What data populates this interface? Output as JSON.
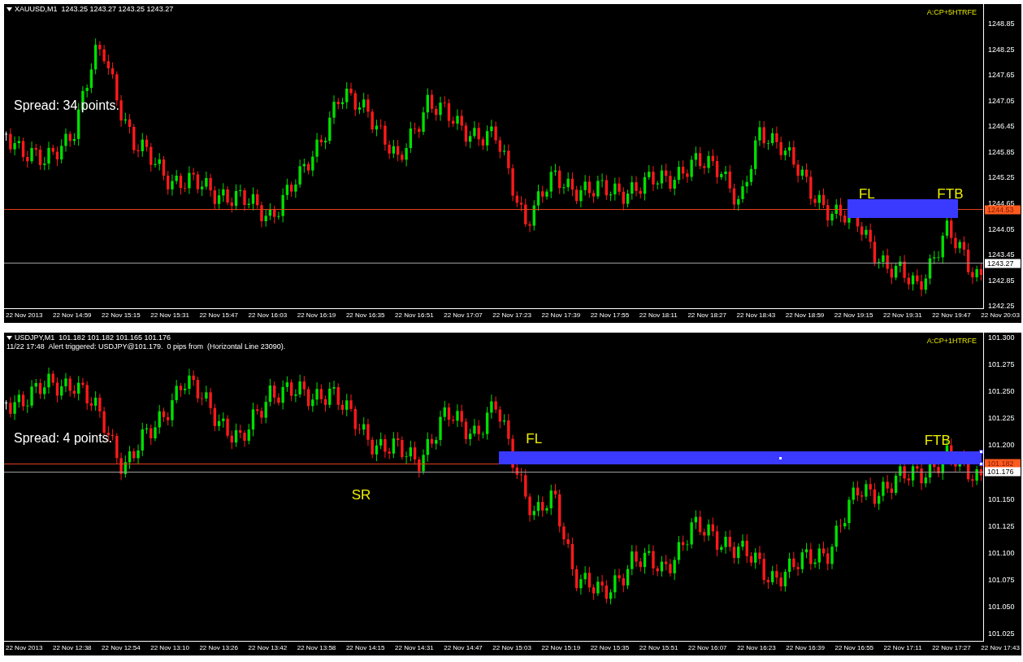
{
  "charts": [
    {
      "header": "XAUUSD,M1  1243.25 1243.27 1243.25 1243.27",
      "broker_label": "A:CP+5HTRFE",
      "spread": "Spread: 34 points.",
      "annotations": [
        {
          "text": "FL"
        },
        {
          "text": "FTB"
        }
      ],
      "price_ticks": [
        "1248.85",
        "1248.25",
        "1247.65",
        "1247.05",
        "1246.45",
        "1245.85",
        "1245.25",
        "1244.65",
        "1244.05",
        "1243.45",
        "1242.85",
        "1242.25"
      ],
      "price_badges": [
        {
          "kind": "line",
          "text": "1244.53"
        },
        {
          "kind": "bid",
          "text": "1243.27"
        }
      ],
      "time_labels": [
        "22 Nov 2013",
        "22 Nov 14:59",
        "22 Nov 15:15",
        "22 Nov 15:31",
        "22 Nov 15:47",
        "22 Nov 16:03",
        "22 Nov 16:19",
        "22 Nov 16:35",
        "22 Nov 16:51",
        "22 Nov 17:07",
        "22 Nov 17:23",
        "22 Nov 17:39",
        "22 Nov 17:55",
        "22 Nov 18:11",
        "22 Nov 18:27",
        "22 Nov 18:43",
        "22 Nov 18:59",
        "22 Nov 19:15",
        "22 Nov 19:31",
        "22 Nov 19:47",
        "22 Nov 20:03"
      ]
    },
    {
      "header": "USDJPY,M1  101.182 101.182 101.165 101.176",
      "alert": "11/22 17:48  Alert triggered: USDJPY@101.179.  0 pips from  (Horizontal Line 23090).",
      "broker_label": "A:CP+1HTRFE",
      "spread": "Spread: 4 points.",
      "annotations": [
        {
          "text": "FL"
        },
        {
          "text": "FTB"
        },
        {
          "text": "SR"
        }
      ],
      "price_ticks": [
        "101.300",
        "101.275",
        "101.250",
        "101.225",
        "101.200",
        "101.150",
        "101.125",
        "101.100",
        "101.075",
        "101.050",
        "101.025"
      ],
      "price_badges": [
        {
          "kind": "line",
          "text": "101.182"
        },
        {
          "kind": "bid",
          "text": "101.176"
        }
      ],
      "time_labels": [
        "22 Nov 2013",
        "22 Nov 12:38",
        "22 Nov 12:54",
        "22 Nov 13:10",
        "22 Nov 13:26",
        "22 Nov 13:42",
        "22 Nov 13:58",
        "22 Nov 14:15",
        "22 Nov 14:31",
        "22 Nov 14:47",
        "22 Nov 15:03",
        "22 Nov 15:19",
        "22 Nov 15:35",
        "22 Nov 15:51",
        "22 Nov 16:07",
        "22 Nov 16:23",
        "22 Nov 16:39",
        "22 Nov 16:55",
        "22 Nov 17:11",
        "22 Nov 17:27",
        "22 Nov 17:43"
      ]
    }
  ]
}
